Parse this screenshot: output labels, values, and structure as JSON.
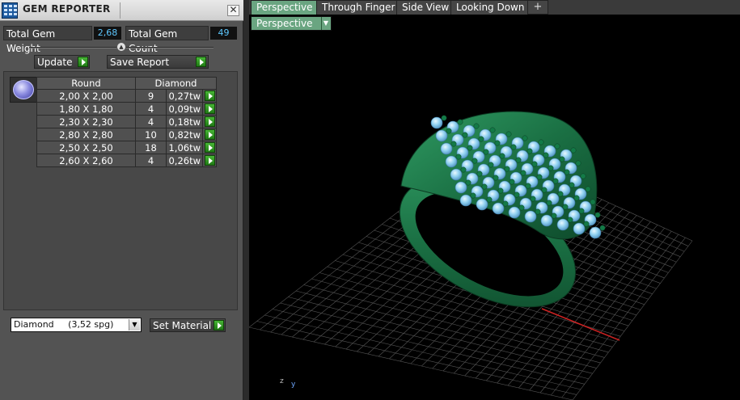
{
  "panel": {
    "title": "GEM REPORTER",
    "close_glyph": "✕",
    "total_weight_label": "Total Gem Weight",
    "total_weight_value": "2,68",
    "total_count_label": "Total Gem Count",
    "total_count_value": "49",
    "update_label": "Update",
    "save_report_label": "Save Report",
    "table": {
      "shape_header": "Round",
      "stone_header": "Diamond",
      "rows": [
        {
          "size": "2,00 X 2,00",
          "qty": "9",
          "weight": "0,27tw"
        },
        {
          "size": "1,80 X 1,80",
          "qty": "4",
          "weight": "0,09tw"
        },
        {
          "size": "2,30 X 2,30",
          "qty": "4",
          "weight": "0,18tw"
        },
        {
          "size": "2,80 X 2,80",
          "qty": "10",
          "weight": "0,82tw"
        },
        {
          "size": "2,50 X 2,50",
          "qty": "18",
          "weight": "1,06tw"
        },
        {
          "size": "2,60 X 2,60",
          "qty": "4",
          "weight": "0,26tw"
        }
      ]
    },
    "material_value": "Diamond     (3,52 spg)",
    "set_material_label": "Set Material"
  },
  "viewport": {
    "tabs": [
      "Perspective",
      "Through Finger",
      "Side View",
      "Looking Down"
    ],
    "active_tab": "Perspective",
    "add_tab_glyph": "+",
    "view_selector": "Perspective",
    "axis_z": "z",
    "axis_y": "y"
  },
  "colors": {
    "tab_active": "#6aa581",
    "panel_bg": "#535353",
    "value_text": "#5ec8ff",
    "ring_metal": "#1f7a4a",
    "gem": "#8fd0f0",
    "grid": "#555555",
    "axis_x": "#cc2222"
  }
}
